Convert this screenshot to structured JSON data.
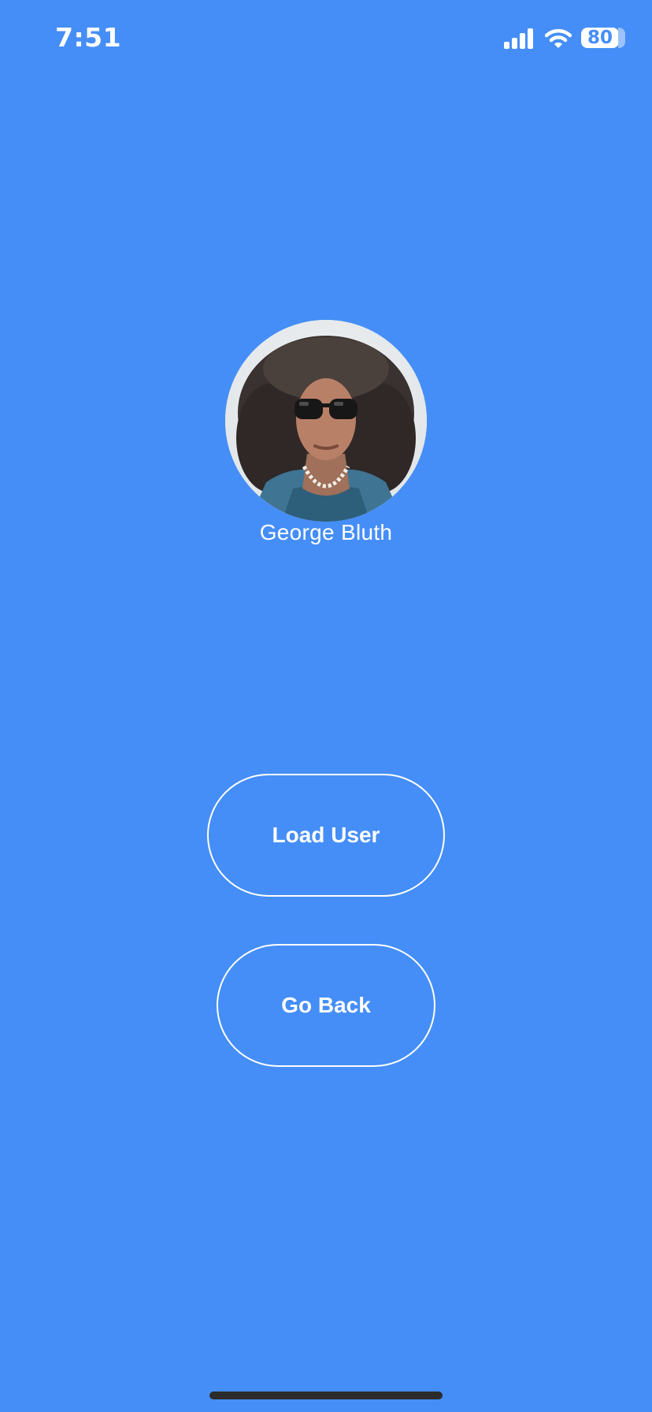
{
  "status_bar": {
    "time": "7:51",
    "battery_level": "80",
    "icons": [
      "signal-icon",
      "wifi-icon",
      "battery-icon"
    ]
  },
  "profile": {
    "name": "George Bluth"
  },
  "actions": {
    "load_user_label": "Load User",
    "go_back_label": "Go Back"
  },
  "colors": {
    "background": "#458EF7",
    "text": "#FFFFFF",
    "button_border": "#FFFFFF",
    "home_indicator": "#2B2B2B"
  }
}
